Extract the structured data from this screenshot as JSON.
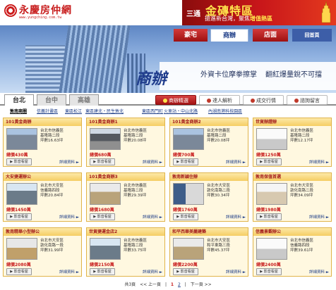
{
  "brand": {
    "name": "永慶房仲網",
    "url": "www.yungching.com.tw"
  },
  "promo": {
    "tag": "三通",
    "headline": "金磚特區",
    "sub": "搶進新台灣，聚焦",
    "hot": "增值熱區"
  },
  "banner": {
    "tabs": [
      "豪宅",
      "商辦",
      "店面",
      "回首頁"
    ],
    "title": "商辦",
    "slogan1": "外資卡位摩拳擦掌",
    "slogan2": "翻紅爆量銳不可擋"
  },
  "regions": [
    "台北",
    "台中",
    "高雄"
  ],
  "menu": [
    "商辦精選",
    "達人解析",
    "成交行情",
    "諮詢留言"
  ],
  "sublinks": [
    "敦南商圈",
    "信義計畫區",
    "東區松江",
    "東區建北・民生敦北",
    "東區西門町",
    "火車站・中山北路",
    "內湖南港科技園區"
  ],
  "cards": [
    {
      "title": "101黃金商辦",
      "info": [
        "台北市信義區",
        "基隆路二段",
        "坪數16.63坪"
      ],
      "price": "總價430萬",
      "video": "影音看屋",
      "detail": "詳細資料"
    },
    {
      "title": "101黃金商辦1",
      "info": [
        "台北市信義區",
        "基隆路二段",
        "坪數20.08坪"
      ],
      "price": "總價680萬",
      "video": "影音看屋",
      "detail": "詳細資料"
    },
    {
      "title": "101黃金商辦2",
      "info": [
        "台北市信義區",
        "基隆路二段",
        "坪數20.08坪"
      ],
      "price": "總價700萬",
      "video": "影音看屋",
      "detail": "詳細資料"
    },
    {
      "title": "世貿辦證辦",
      "info": [
        "台北市信義區",
        "基隆路二段",
        "坪數12.17坪"
      ],
      "price": "總價1250萬",
      "video": "影音看屋",
      "detail": "詳細資料"
    },
    {
      "title": "大安捷運辦公",
      "info": [
        "台北市大安區",
        "信義路四段",
        "坪數20.84坪"
      ],
      "price": "總價1450萬",
      "video": "影音看屋",
      "detail": "詳細資料"
    },
    {
      "title": "101黃金商辦3",
      "info": [
        "台北市信義區",
        "基隆路二段",
        "坪數29.39坪"
      ],
      "price": "總價1680萬",
      "video": "影音看屋",
      "detail": "詳細資料"
    },
    {
      "title": "敦南新穎住辦",
      "info": [
        "台北市大安區",
        "敦化南路二段",
        "坪數30.34坪"
      ],
      "price": "總價1760萬",
      "video": "影音看屋",
      "detail": "詳細資料"
    },
    {
      "title": "敦南保值首選",
      "info": [
        "台北市大安區",
        "敦化南路二段",
        "坪數34.09坪"
      ],
      "price": "總價1980萬",
      "video": "影音看屋",
      "detail": "詳細資料"
    },
    {
      "title": "敦南精華小型辦公",
      "info": [
        "台北市大安區",
        "敦化南路一段",
        "坪數31.99坪"
      ],
      "price": "總價2080萬",
      "video": "影音看屋",
      "detail": "詳細資料"
    },
    {
      "title": "世貿捷運金店2",
      "info": [
        "台北市信義區",
        "基隆路二段",
        "坪數33.75坪"
      ],
      "price": "總價2150萬",
      "video": "影音看屋",
      "detail": "詳細資料"
    },
    {
      "title": "和平西華美麗建築",
      "info": [
        "台北市大安區",
        "和平東路三段",
        "坪數45.37坪"
      ],
      "price": "總價2200萬",
      "video": "影音看屋",
      "detail": "詳細資料"
    },
    {
      "title": "信義景觀辦公",
      "info": [
        "台北市信義區",
        "信義路四段",
        "坪數39.61坪"
      ],
      "price": "總價2400萬",
      "video": "影音看屋",
      "detail": "詳細資料"
    }
  ],
  "pager": {
    "total": "共3頁",
    "prev": "<< 上一頁",
    "sep1": "|",
    "current": "1",
    "page2": "2",
    "sep2": "|",
    "next": "下一頁 >>"
  },
  "colors": {
    "brand_red": "#c81e1e",
    "link_blue": "#1d3d87",
    "card_border": "#e0b44a"
  }
}
